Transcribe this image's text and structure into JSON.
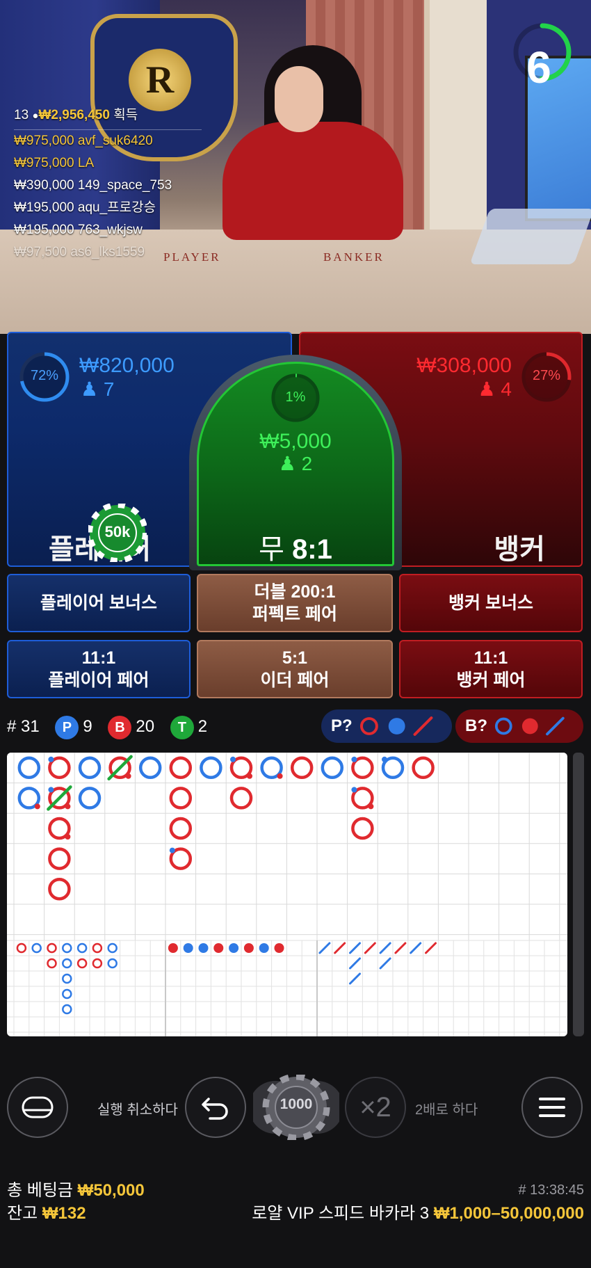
{
  "video": {
    "timer": "6",
    "table_labels": {
      "player": "PLAYER",
      "banker": "BANKER"
    },
    "emblem_letter": "R",
    "winners": {
      "count": "13",
      "total": "₩2,956,450",
      "total_suffix": "획득",
      "rows": [
        {
          "amount": "₩975,000",
          "name": "avf_suk6420",
          "highlight": true
        },
        {
          "amount": "₩975,000",
          "name": "LA",
          "highlight": true
        },
        {
          "amount": "₩390,000",
          "name": "149_space_753",
          "highlight": false
        },
        {
          "amount": "₩195,000",
          "name": "aqu_프로강승",
          "highlight": false
        },
        {
          "amount": "₩195,000",
          "name": "763_wkjsw",
          "highlight": false
        },
        {
          "amount": "₩97,500",
          "name": "as6_lks1559",
          "highlight": false
        }
      ]
    }
  },
  "bets": {
    "player": {
      "percent": 72,
      "percent_label": "72%",
      "amount": "₩820,000",
      "players": "7",
      "title": "플레이어",
      "chip": "50k"
    },
    "banker": {
      "percent": 27,
      "percent_label": "27%",
      "amount": "₩308,000",
      "players": "4",
      "title": "뱅커"
    },
    "tie": {
      "percent": 1,
      "percent_label": "1%",
      "amount": "₩5,000",
      "players": "2",
      "title": "무",
      "payout": "8:1"
    }
  },
  "side_bets": [
    {
      "line1": "플레이어 보너스",
      "line2": ""
    },
    {
      "line1": "더블 200:1",
      "line2": "퍼펙트 페어"
    },
    {
      "line1": "뱅커 보너스",
      "line2": ""
    },
    {
      "line1": "11:1",
      "line2": "플레이어 페어"
    },
    {
      "line1": "5:1",
      "line2": "이더 페어"
    },
    {
      "line1": "11:1",
      "line2": "뱅커 페어"
    }
  ],
  "stats": {
    "round_label": "# 31",
    "p_letter": "P",
    "p_count": "9",
    "b_letter": "B",
    "b_count": "20",
    "t_letter": "T",
    "t_count": "2",
    "p_predict": "P?",
    "b_predict": "B?"
  },
  "colors": {
    "player": "#2f7ae5",
    "banker": "#e02a2f",
    "tie": "#1fa83a",
    "gold": "#f5c63a"
  },
  "controls": {
    "undo_label": "실행 취소하다",
    "chip_value": "1000",
    "double_symbol": "×2",
    "double_label": "2배로 하다"
  },
  "footer": {
    "total_bet_label": "총 베팅금",
    "total_bet": "₩50,000",
    "balance_label": "잔고",
    "balance": "₩132",
    "time": "# 13:38:45",
    "table_name": "로얄 VIP 스피드 바카라 3",
    "limits": "₩1,000–50,000,000"
  }
}
